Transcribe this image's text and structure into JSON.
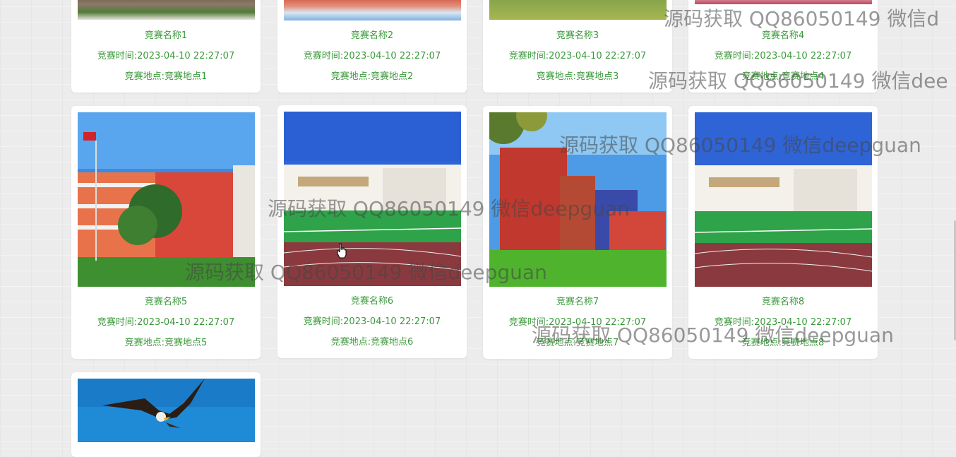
{
  "cards": [
    {
      "name": "竞赛名称1",
      "time": "竞赛时间:2023-04-10 22:27:07",
      "place": "竞赛地点:竞赛地点1",
      "image": "school-campus-photo"
    },
    {
      "name": "竞赛名称2",
      "time": "竞赛时间:2023-04-10 22:27:07",
      "place": "竞赛地点:竞赛地点2",
      "image": "flower-garden-photo"
    },
    {
      "name": "竞赛名称3",
      "time": "竞赛时间:2023-04-10 22:27:07",
      "place": "竞赛地点:竞赛地点3",
      "image": "grass-field-photo"
    },
    {
      "name": "竞赛名称4",
      "time": "竞赛时间:2023-04-10 22:27:07",
      "place": "竞赛地点:竞赛地点4",
      "image": "flower-photo"
    },
    {
      "name": "竞赛名称5",
      "time": "竞赛时间:2023-04-10 22:27:07",
      "place": "竞赛地点:竞赛地点5",
      "image": "red-brick-school-photo"
    },
    {
      "name": "竞赛名称6",
      "time": "竞赛时间:2023-04-10 22:27:07",
      "place": "竞赛地点:竞赛地点6",
      "image": "stadium-school-photo"
    },
    {
      "name": "竞赛名称7",
      "time": "竞赛时间:2023-04-10 22:27:07",
      "place": "竞赛地点:竞赛地点7",
      "image": "school-building-tree-photo"
    },
    {
      "name": "竞赛名称8",
      "time": "竞赛时间:2023-04-10 22:27:07",
      "place": "竞赛地点:竞赛地点8",
      "image": "stadium-school-photo"
    },
    {
      "name": "",
      "time": "",
      "place": "",
      "image": "eagle-sky-photo"
    }
  ],
  "watermarks": [
    "源码获取 QQ86050149 微信d",
    "源码获取 QQ86050149 微信dee",
    "源码获取 QQ86050149 微信deepguan",
    "源码获取 QQ86050149 微信deepguan",
    "源码获取 QQ86050149 微信deepguan",
    "源码获取 QQ86050149 微信deepguan"
  ],
  "colors": {
    "accent_text": "#3a9a3a",
    "card_bg": "#ffffff",
    "page_bg": "#ececec"
  }
}
